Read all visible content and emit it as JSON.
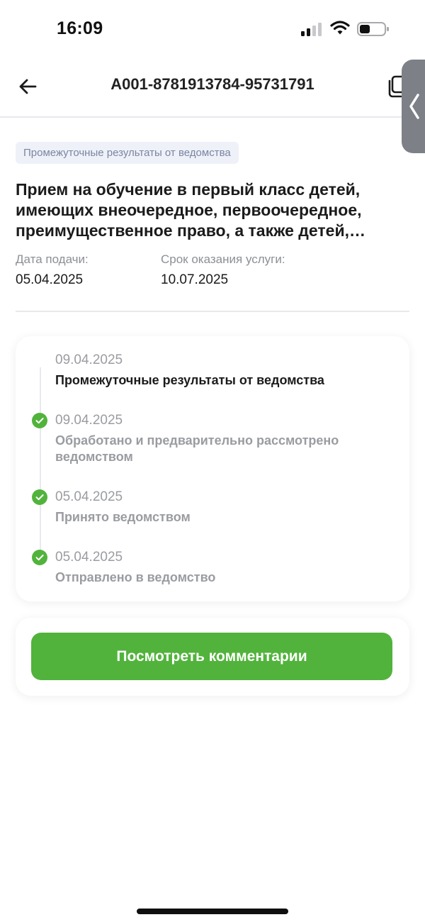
{
  "status_bar": {
    "time": "16:09"
  },
  "header": {
    "order_number": "A001-8781913784-95731791"
  },
  "application": {
    "status_chip": "Промежуточные результаты от ведомства",
    "title": "Прием на обучение в первый класс детей, имеющих внеочередное, первоочередное, преимущественное право, а также детей, проживающих на закрепленной территории",
    "submission_date_label": "Дата подачи:",
    "submission_date": "05.04.2025",
    "deadline_label": "Срок оказания услуги:",
    "deadline": "10.07.2025"
  },
  "timeline": {
    "steps": [
      {
        "date": "09.04.2025",
        "label": "Промежуточные результаты от ведомства",
        "completed": false,
        "current": true
      },
      {
        "date": "09.04.2025",
        "label": "Обработано и предварительно рассмотрено ведомством",
        "completed": true,
        "current": false
      },
      {
        "date": "05.04.2025",
        "label": "Принято ведомством",
        "completed": true,
        "current": false
      },
      {
        "date": "05.04.2025",
        "label": "Отправлено в ведомство",
        "completed": true,
        "current": false
      }
    ]
  },
  "comments_button_label": "Посмотреть комментарии",
  "icons": {
    "back": "arrow-left-icon",
    "copy": "copy-icon",
    "handle": "chevron-left-icon",
    "step_done": "check-circle-icon"
  },
  "colors": {
    "accent_green": "#52b33c",
    "chip_bg": "#eef1f8",
    "chip_text": "#7c85a2"
  }
}
